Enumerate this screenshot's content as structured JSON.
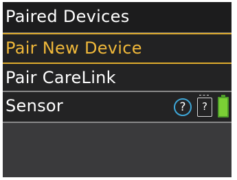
{
  "header": {
    "title": "Paired Devices"
  },
  "menu": {
    "items": [
      {
        "label": "Pair New Device",
        "selected": true
      },
      {
        "label": "Pair CareLink",
        "selected": false
      },
      {
        "label": "Sensor",
        "selected": false
      }
    ]
  },
  "sensor_status": {
    "connection_icon": "question-circle-icon",
    "connection_text": "?",
    "sensor_icon": "sensor-question-icon",
    "sensor_text": "?",
    "battery_icon": "battery-full-icon",
    "battery_level": 1.0
  },
  "colors": {
    "selection_accent": "#e0ac2e",
    "selected_text": "#f0b83a",
    "connection_ring": "#3ea7d8",
    "battery_fill": "#7bd035"
  }
}
